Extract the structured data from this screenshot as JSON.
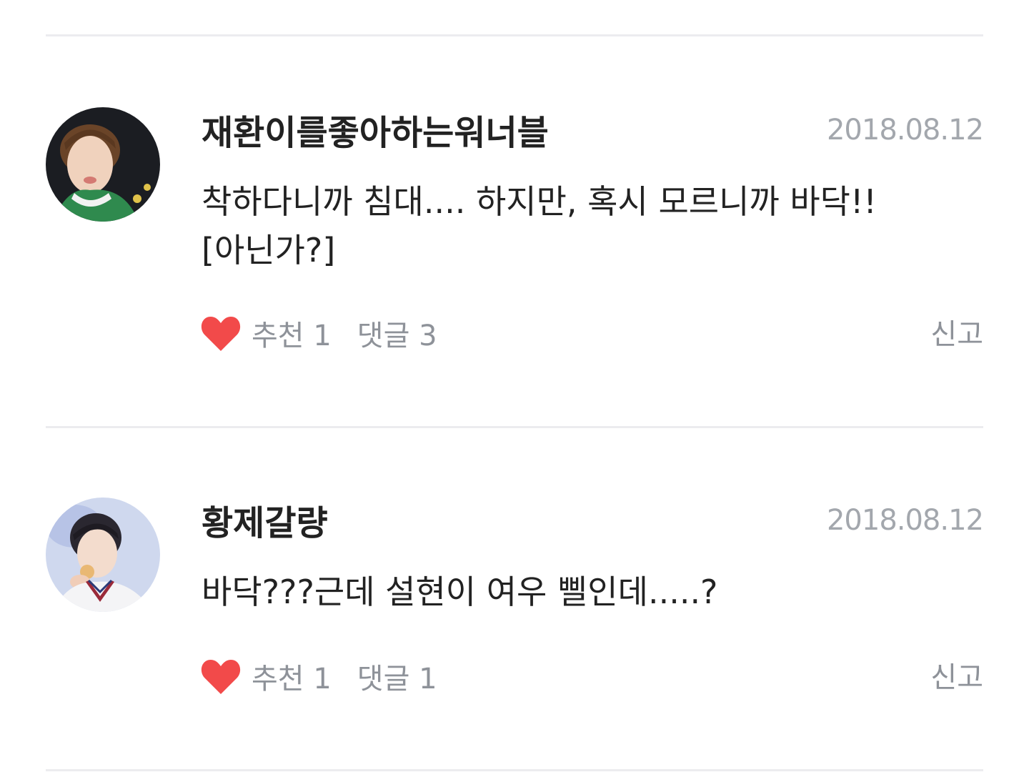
{
  "comments": [
    {
      "author": "재환이를좋아하는워너블",
      "date": "2018.08.12",
      "text": "착하다니까 침대.... 하지만, 혹시 모르니까 바닥!!\n[아닌가?]",
      "like_label": "추천 1",
      "reply_label": "댓글 3",
      "report_label": "신고"
    },
    {
      "author": "황제갈량",
      "date": "2018.08.12",
      "text": "바닥???근데 설현이 여우 삘인데.....?",
      "like_label": "추천 1",
      "reply_label": "댓글 1",
      "report_label": "신고"
    }
  ],
  "colors": {
    "heart": "#f24a4a",
    "text": "#222222",
    "meta": "#8e9299",
    "date": "#a3a7ad",
    "divider": "#ececef"
  },
  "icons": [
    "heart-icon"
  ]
}
